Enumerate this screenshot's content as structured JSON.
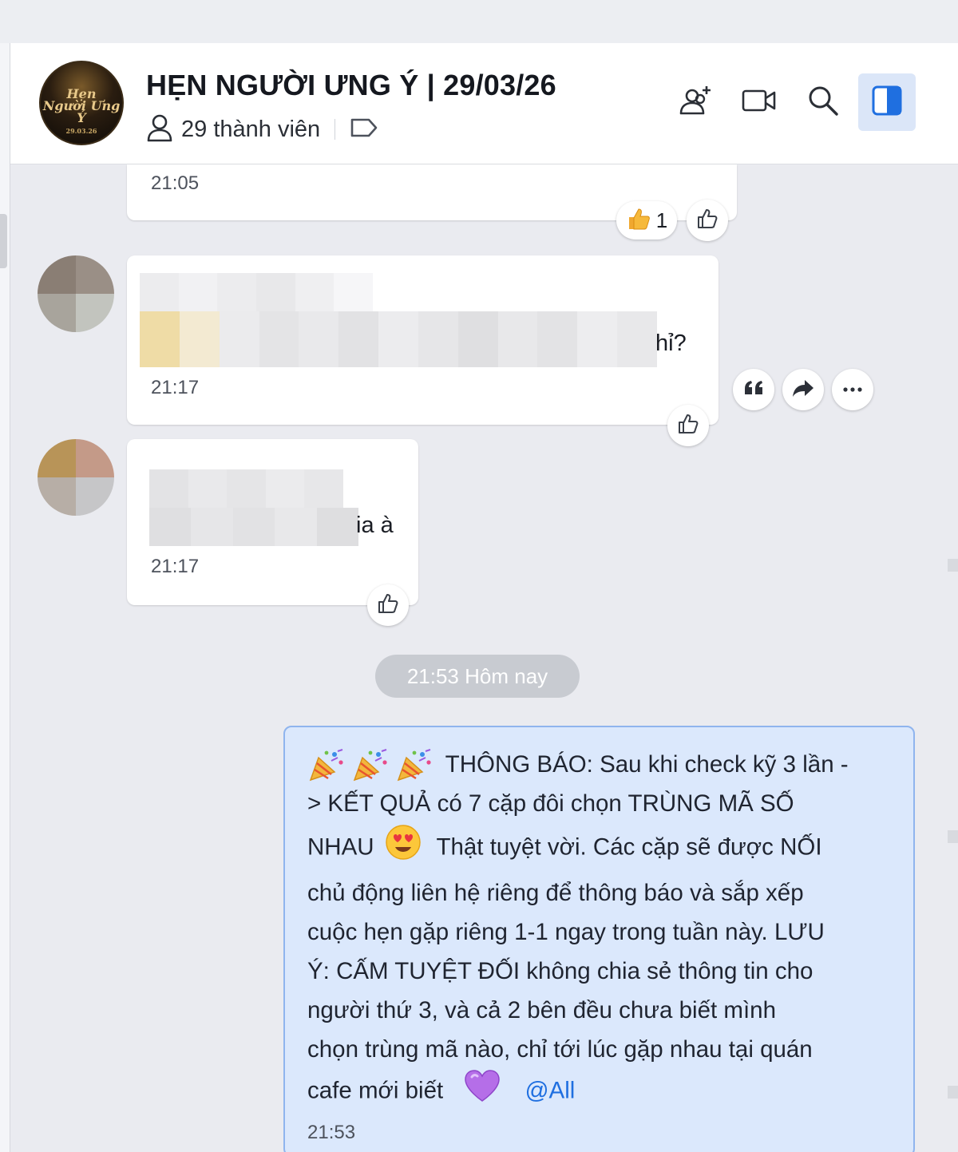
{
  "header": {
    "title": "HẸN NGƯỜI ƯNG Ý | 29/03/26",
    "member_count": "29 thành viên",
    "avatar_logo_line1": "Hẹn",
    "avatar_logo_line2": "Người Ưng Ý",
    "avatar_logo_date": "29.03.26",
    "icons": [
      "add-member-icon",
      "video-call-icon",
      "search-icon",
      "sidebar-toggle-icon"
    ]
  },
  "messages": [
    {
      "time": "21:05",
      "reaction_count": "1"
    },
    {
      "text_visible": "hỉ?",
      "time": "21:17"
    },
    {
      "text_visible": "ia à",
      "time": "21:17"
    }
  ],
  "date_separator": "21:53 Hôm nay",
  "own_message": {
    "line1": "THÔNG BÁO: Sau khi check kỹ 3 lần -",
    "line2": "> KẾT QUẢ có 7 cặp đôi chọn TRÙNG MÃ SỐ",
    "line3a": "NHAU",
    "line3b": "Thật tuyệt vời. Các cặp sẽ được NỐI",
    "line4": "chủ động liên hệ riêng để thông báo và sắp xếp",
    "line5": "cuộc hẹn gặp riêng 1-1 ngay trong tuần này. LƯU",
    "line6": "Ý: CẤM TUYỆT ĐỐI không chia sẻ thông tin cho",
    "line7": "người thứ 3, và cả 2 bên đều chưa biết mình",
    "line8": "chọn trùng mã nào, chỉ tới lúc gặp nhau tại quán",
    "line9": "cafe mới biết",
    "mention": "@All",
    "time": "21:53"
  },
  "colors": {
    "accent": "#1f6fe0",
    "own_bubble": "#dbe8fc",
    "own_border": "#8fb4ee",
    "background": "#eaebf0"
  }
}
